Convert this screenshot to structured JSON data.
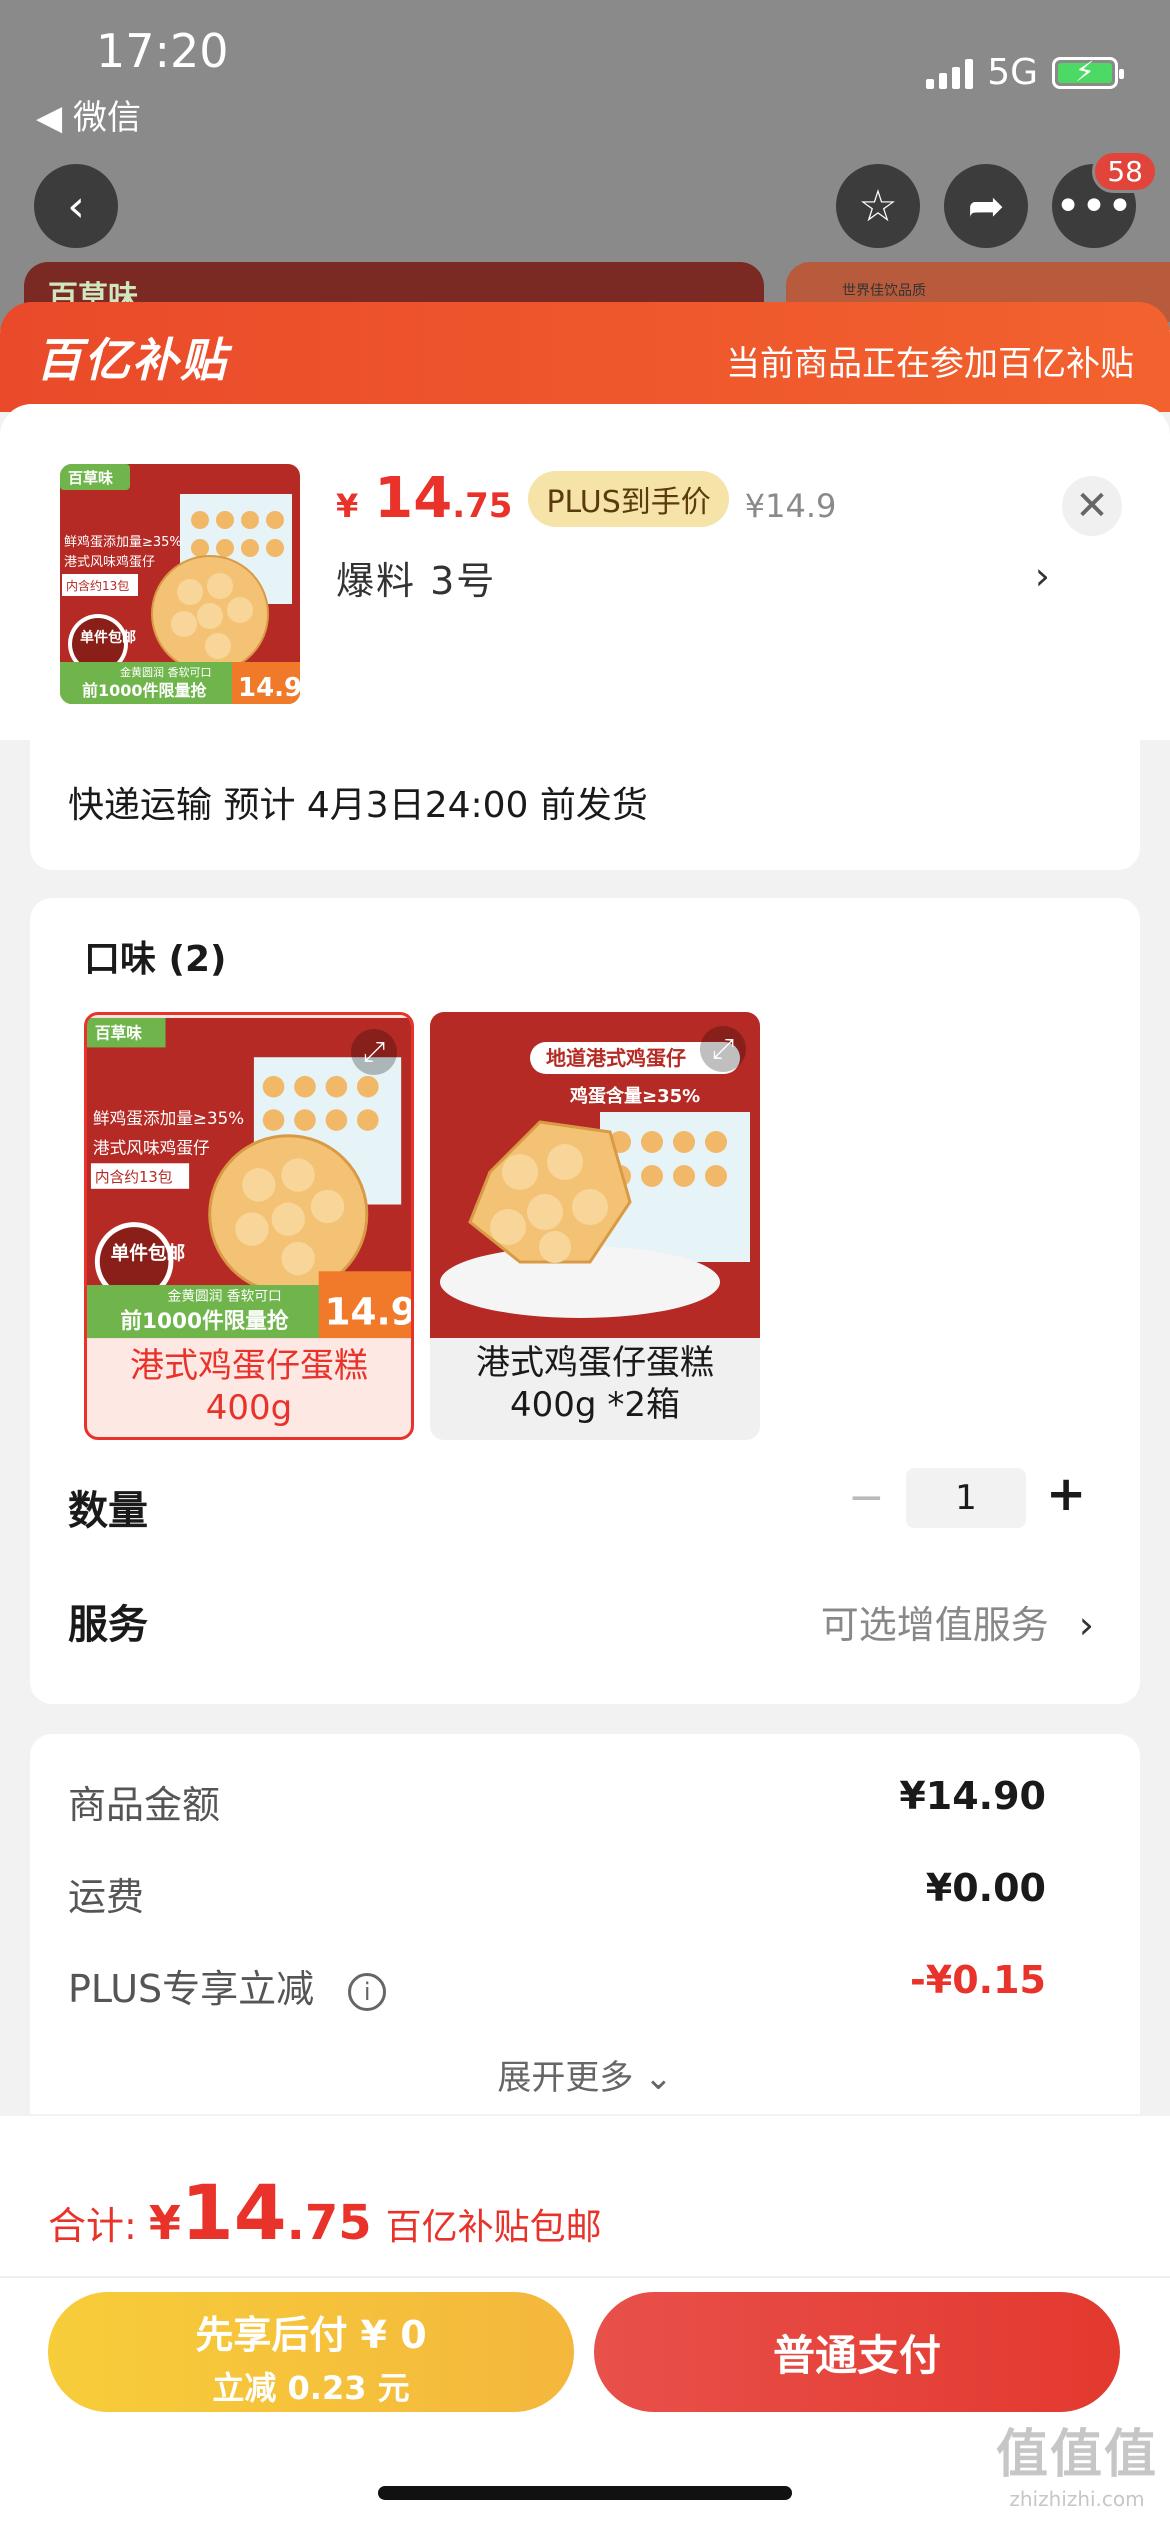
{
  "status_bar": {
    "time": "17:20",
    "back_app": "◀ 微信",
    "network": "5G"
  },
  "nav": {
    "cart_badge": "58"
  },
  "ghost": {
    "logo": "百草味",
    "right_text": "世界佳饮品质"
  },
  "banner": {
    "logo": "百亿补贴",
    "tip": "当前商品正在参加百亿补贴"
  },
  "product": {
    "currency": "¥",
    "price_int": "14",
    "price_dec": ".75",
    "plus_tag": "PLUS到手价",
    "original_price": "¥14.9",
    "variant": "爆料  3号",
    "thumb": {
      "logo": "百草味",
      "lines": [
        "鲜鸡蛋添加量≥35%",
        "港式风味鸡蛋仔",
        "内含约13包"
      ],
      "badge": "单件包邮",
      "slogan": "金黄圆润 香软可口",
      "promo": "前1000件限量抢",
      "price": "14.9"
    }
  },
  "shipping": {
    "text": "快递运输 预计 4月3日24:00 前发货"
  },
  "spec": {
    "title": "口味 (2)",
    "options": [
      {
        "label": "港式鸡蛋仔蛋糕\n400g",
        "selected": true
      },
      {
        "label": "港式鸡蛋仔蛋糕\n400g *2箱",
        "selected": false
      }
    ],
    "opt2_img": {
      "top_text": "地道港式鸡蛋仔",
      "sub_text": "鸡蛋含量≥35%"
    }
  },
  "quantity": {
    "label": "数量",
    "minus": "−",
    "value": "1",
    "plus": "+"
  },
  "service": {
    "label": "服务",
    "value": "可选增值服务",
    "arrow": "›"
  },
  "summary": {
    "rows": [
      {
        "key": "商品金额",
        "value": "¥14.90"
      },
      {
        "key": "运费",
        "value": "¥0.00"
      },
      {
        "key": "PLUS专享立减",
        "value": "-¥0.15"
      }
    ],
    "expand": "展开更多 ⌄"
  },
  "footer": {
    "total_label": "合计:",
    "total_cur": "¥",
    "total_int": "14",
    "total_dec": ".75",
    "total_note": "百亿补贴包邮",
    "later_line1": "先享后付 ¥ 0",
    "later_line2": "立减 0.23 元",
    "pay_label": "普通支付"
  },
  "watermark": {
    "main": "值值值",
    "sub": "zhizhizhi.com"
  },
  "colors": {
    "accent_red": "#e8322a",
    "banner_orange": "#ea4a2a",
    "gold": "#f7cd3a"
  }
}
